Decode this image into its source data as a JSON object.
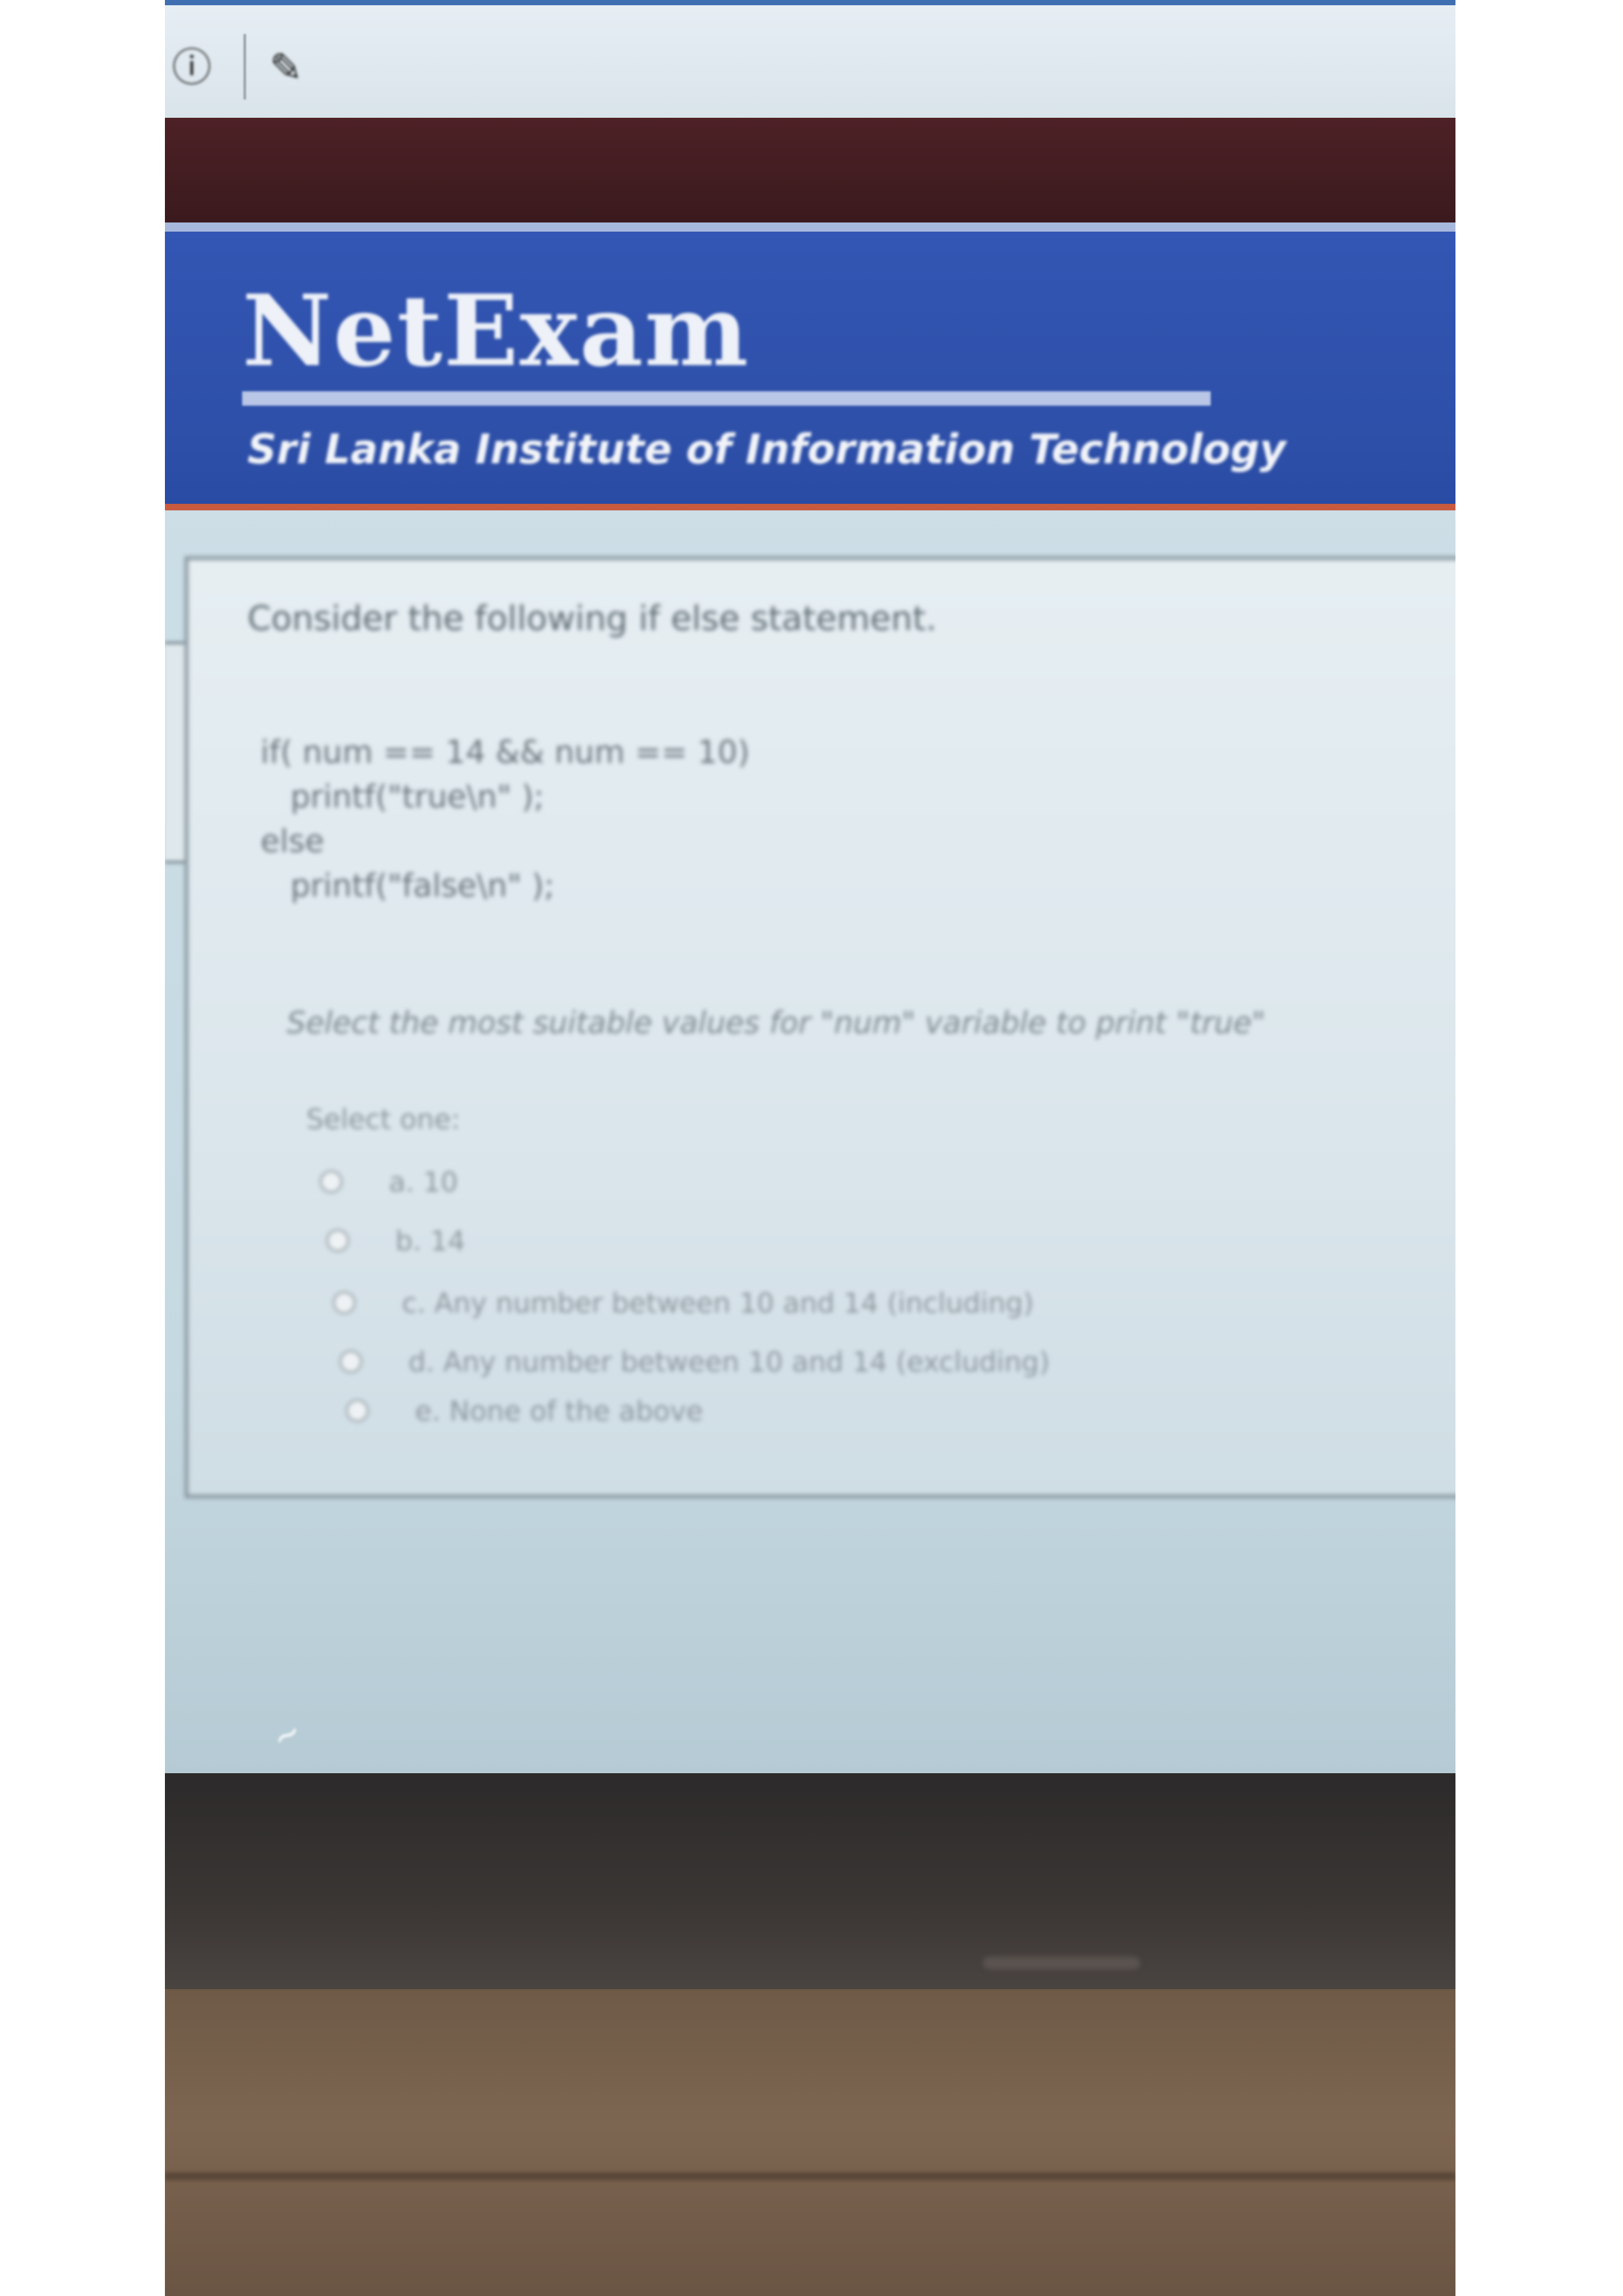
{
  "browser": {
    "info_icon": "info-icon",
    "edit_icon": "edit-icon",
    "info_glyph": "ⓘ",
    "edit_glyph": "✎"
  },
  "header": {
    "title": "NetExam",
    "subtitle": "Sri Lanka Institute of Information Technology"
  },
  "question": {
    "intro": "Consider the following if else statement.",
    "code": [
      "if( num == 14 && num == 10)",
      "   printf(\"true\\n\" );",
      "else",
      "   printf(\"false\\n\" );"
    ],
    "prompt": "Select the most suitable values for \"num\" variable to print \"true\"",
    "select_one": "Select one:",
    "options": [
      "a. 10",
      "b. 14",
      "c. Any number between 10 and 14 (including)",
      "d. Any number between 10 and 14 (excluding)",
      "e. None of the above"
    ]
  },
  "colors": {
    "banner": "#3356b4",
    "banner_accent": "#c85a40",
    "page_bg": "#dbe6ec"
  }
}
